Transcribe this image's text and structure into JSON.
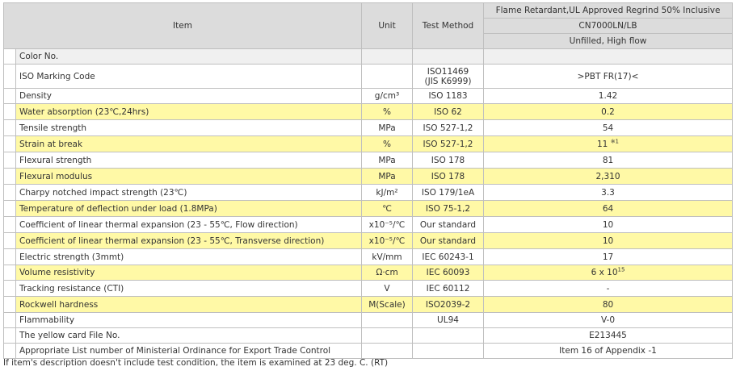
{
  "header": {
    "item": "Item",
    "unit": "Unit",
    "test_method": "Test Method",
    "product_line": "Flame Retardant,UL Approved Regrind 50% Inclusive",
    "grade": "CN7000LN/LB",
    "grade_note": "Unfilled, High flow"
  },
  "color_row": {
    "label": "Color No.",
    "unit": "",
    "method": "",
    "value": ""
  },
  "marking_row": {
    "label": "ISO Marking Code",
    "unit": "",
    "method_line1": "ISO11469",
    "method_line2": "(JIS K6999)",
    "value": ">PBT FR(17)<"
  },
  "rows": [
    {
      "item": "Density",
      "unit": "g/cm³",
      "method": "ISO 1183",
      "value": "1.42",
      "value_sup": "",
      "highlight": false
    },
    {
      "item": "Water absorption (23℃,24hrs)",
      "unit": "%",
      "method": "ISO 62",
      "value": "0.2",
      "value_sup": "",
      "highlight": true
    },
    {
      "item": "Tensile strength",
      "unit": "MPa",
      "method": "ISO 527-1,2",
      "value": "54",
      "value_sup": "",
      "highlight": false
    },
    {
      "item": "Strain at break",
      "unit": "%",
      "method": "ISO 527-1,2",
      "value": "11",
      "value_sup": "※1",
      "highlight": true
    },
    {
      "item": "Flexural strength",
      "unit": "MPa",
      "method": "ISO 178",
      "value": "81",
      "value_sup": "",
      "highlight": false
    },
    {
      "item": "Flexural modulus",
      "unit": "MPa",
      "method": "ISO 178",
      "value": "2,310",
      "value_sup": "",
      "highlight": true
    },
    {
      "item": "Charpy notched impact strength (23℃)",
      "unit": "kJ/m²",
      "method": "ISO 179/1eA",
      "value": "3.3",
      "value_sup": "",
      "highlight": false
    },
    {
      "item": "Temperature of deflection under load (1.8MPa)",
      "unit": "℃",
      "method": "ISO 75-1,2",
      "value": "64",
      "value_sup": "",
      "highlight": true
    },
    {
      "item": "Coefficient of linear thermal expansion (23 - 55℃, Flow direction)",
      "unit": "x10⁻⁵/℃",
      "method": "Our standard",
      "value": "10",
      "value_sup": "",
      "highlight": false
    },
    {
      "item": "Coefficient of linear thermal expansion (23 - 55℃, Transverse direction)",
      "unit": "x10⁻⁵/℃",
      "method": "Our standard",
      "value": "10",
      "value_sup": "",
      "highlight": true
    },
    {
      "item": "Electric strength (3mmt)",
      "unit": "kV/mm",
      "method": "IEC 60243-1",
      "value": "17",
      "value_sup": "",
      "highlight": false
    },
    {
      "item": "Volume resistivity",
      "unit": "Ω·cm",
      "method": "IEC 60093",
      "value": "6 x 10",
      "value_sup": "15",
      "highlight": true
    },
    {
      "item": "Tracking resistance (CTI)",
      "unit": "V",
      "method": "IEC 60112",
      "value": "-",
      "value_sup": "",
      "highlight": false
    },
    {
      "item": "Rockwell hardness",
      "unit": "M(Scale)",
      "method": "ISO2039-2",
      "value": "80",
      "value_sup": "",
      "highlight": true
    },
    {
      "item": "Flammability",
      "unit": "",
      "method": "UL94",
      "value": "V-0",
      "value_sup": "",
      "highlight": false
    },
    {
      "item": "The yellow card File No.",
      "unit": "",
      "method": "",
      "value": "E213445",
      "value_sup": "",
      "highlight": false
    },
    {
      "item": "Appropriate List number of Ministerial Ordinance for Export Trade Control",
      "unit": "",
      "method": "",
      "value": "Item 16 of Appendix -1",
      "value_sup": "",
      "highlight": false
    }
  ],
  "footnote": "If item's description doesn't include test condition, the item is examined at 23 deg. C. (RT)"
}
